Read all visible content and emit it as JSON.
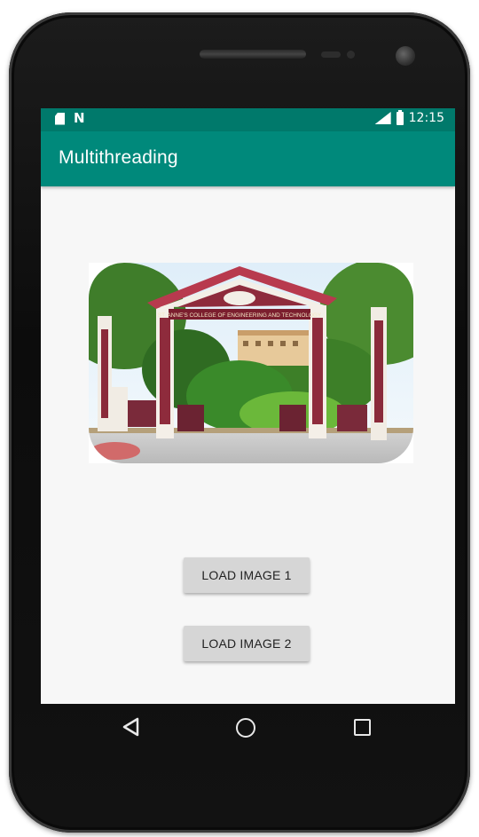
{
  "status_bar": {
    "left_icons": [
      "sim-card-icon",
      "n-notification-icon"
    ],
    "right_icons": [
      "signal-icon",
      "battery-icon"
    ],
    "time": "12:15"
  },
  "app_bar": {
    "title": "Multithreading"
  },
  "content": {
    "image": {
      "gate_banner_text": "ST. ANNE'S COLLEGE OF ENGINEERING AND TECHNOLOGY"
    },
    "buttons": {
      "load_image_1": "LOAD IMAGE 1",
      "load_image_2": "LOAD IMAGE 2"
    }
  },
  "nav_bar": {
    "icons": [
      "back-icon",
      "home-icon",
      "recents-icon"
    ]
  },
  "colors": {
    "status_bar": "#00796b",
    "app_bar": "#00897b",
    "screen_bg": "#f7f7f7",
    "button_bg": "#d6d6d6"
  }
}
